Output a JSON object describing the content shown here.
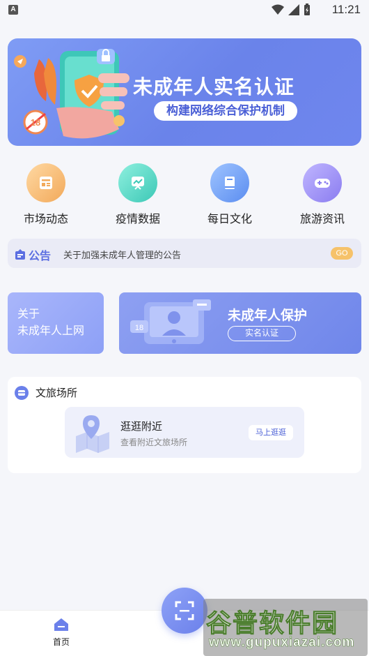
{
  "status_bar": {
    "time": "11:21",
    "notification_icon": "A"
  },
  "banner": {
    "title": "未成年人实名认证",
    "subtitle": "构建网络综合保护机制",
    "badge": "18"
  },
  "quick_links": [
    {
      "label": "市场动态",
      "icon": "newspaper-icon",
      "color": "#f3b56a"
    },
    {
      "label": "疫情数据",
      "icon": "chart-board-icon",
      "color": "#4fd1c5"
    },
    {
      "label": "每日文化",
      "icon": "book-icon",
      "color": "#5b8df0"
    },
    {
      "label": "旅游资讯",
      "icon": "gamepad-icon",
      "color": "#8a7cf0"
    }
  ],
  "notice": {
    "tag": "公告",
    "text": "关于加强未成年人管理的公告",
    "go": "GO"
  },
  "promo_left": {
    "line1": "关于",
    "line2": "未成年人上网"
  },
  "promo_right": {
    "title": "未成年人保护",
    "button": "实名认证",
    "badge": "18"
  },
  "venue": {
    "title": "文旅场所",
    "card": {
      "title": "逛逛附近",
      "subtitle": "查看附近文旅场所",
      "button": "马上逛逛"
    }
  },
  "bottom_nav": {
    "home": "首页"
  },
  "watermark": {
    "main": "谷普软件园",
    "url": "www.gupuxiazai.com"
  },
  "colors": {
    "accent": "#6b80ea",
    "background": "#f5f6fa"
  }
}
